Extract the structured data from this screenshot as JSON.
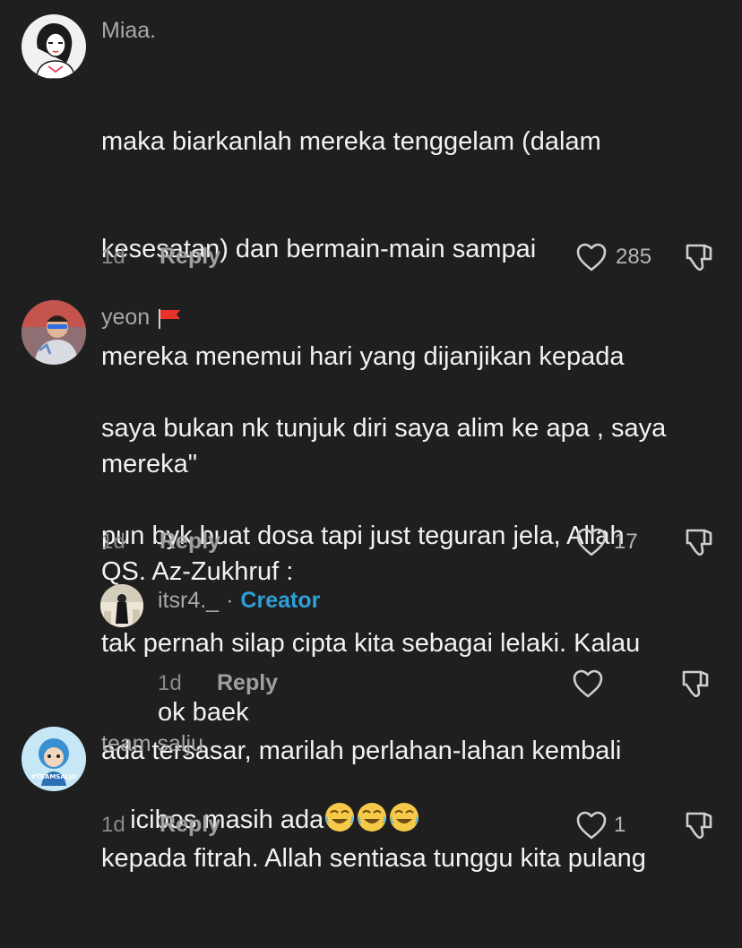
{
  "comments": [
    {
      "username": "Miaa.",
      "lines": [
        "maka biarkanlah mereka tenggelam (dalam",
        "kesesatan) dan bermain-main sampai",
        "mereka menemui hari yang dijanjikan kepada",
        "mereka\"",
        "QS. Az-Zukhruf :"
      ],
      "time": "1d",
      "reply_label": "Reply",
      "likes": "285"
    },
    {
      "username": "yeon",
      "lines": [
        "saya bukan nk tunjuk diri saya alim ke apa , saya",
        "pun byk buat dosa tapi just teguran jela, Allah",
        "tak pernah silap cipta kita sebagai lelaki. Kalau",
        "ada tersasar, marilah perlahan-lahan kembali",
        "kepada fitrah. Allah sentiasa tunggu kita pulang"
      ],
      "time": "1d",
      "reply_label": "Reply",
      "likes": "17"
    },
    {
      "username": "itsr4._",
      "separator": "·",
      "badge": "Creator",
      "lines": [
        "ok baek"
      ],
      "time": "1d",
      "reply_label": "Reply",
      "likes": ""
    },
    {
      "username": "team salju",
      "text": "icibos masih ada",
      "emojis": [
        "😂",
        "😂",
        "😂"
      ],
      "avatar_text": "#TEAMSALJU",
      "time": "1d",
      "reply_label": "Reply",
      "likes": "1"
    }
  ],
  "colors": {
    "background": "#1f1f1f",
    "creator": "#2f9fd8",
    "username": "#a8a8a8",
    "flag": "#e8322b"
  }
}
